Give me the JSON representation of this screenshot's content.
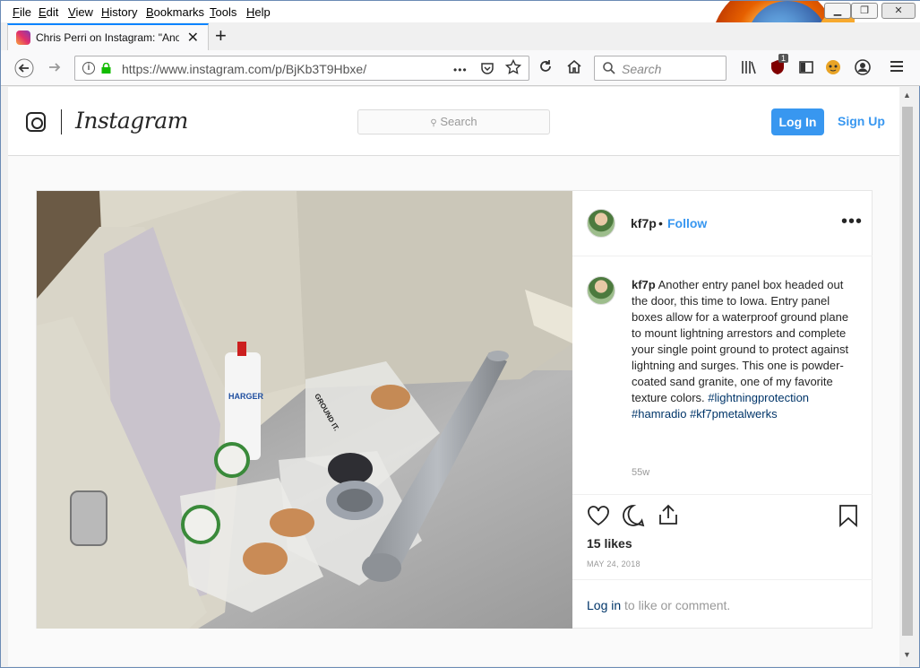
{
  "menu": [
    "File",
    "Edit",
    "View",
    "History",
    "Bookmarks",
    "Tools",
    "Help"
  ],
  "menu_underline": [
    "F",
    "E",
    "V",
    "H",
    "B",
    "T",
    "H"
  ],
  "tab": {
    "title": "Chris Perri on Instagram: \"Anot",
    "close": "✕"
  },
  "new_tab": "+",
  "address": {
    "url": "https://www.instagram.com/p/BjKb3T9Hbxe/",
    "page_actions": "•••"
  },
  "search": {
    "placeholder": "Search"
  },
  "toolbar_badge": "1",
  "instagram": {
    "wordmark": "Instagram",
    "search_placeholder": "Search",
    "login": "Log In",
    "signup": "Sign Up"
  },
  "post": {
    "username": "kf7p",
    "bullet": "•",
    "follow": "Follow",
    "more": "•••",
    "caption_text": "Another entry panel box headed out the door, this time to Iowa. Entry panel boxes allow for a waterproof ground plane to mount lightning arrestors and complete your single point ground to protect against lightning and surges. This one is powder-coated sand granite, one of my favorite texture colors.",
    "hashtags": [
      "#lightningprotection",
      "#hamradio",
      "#kf7pmetalwerks"
    ],
    "age": "55w",
    "likes": "15 likes",
    "date": "MAY 24, 2018",
    "login_link": "Log in",
    "login_rest": " to like or comment."
  },
  "photo_labels": {
    "bottle": "HARGER",
    "bag": "GROUND IT."
  },
  "colors": {
    "accent": "#3897f0",
    "link": "#003569",
    "firefox_tab": "#0a84ff"
  }
}
